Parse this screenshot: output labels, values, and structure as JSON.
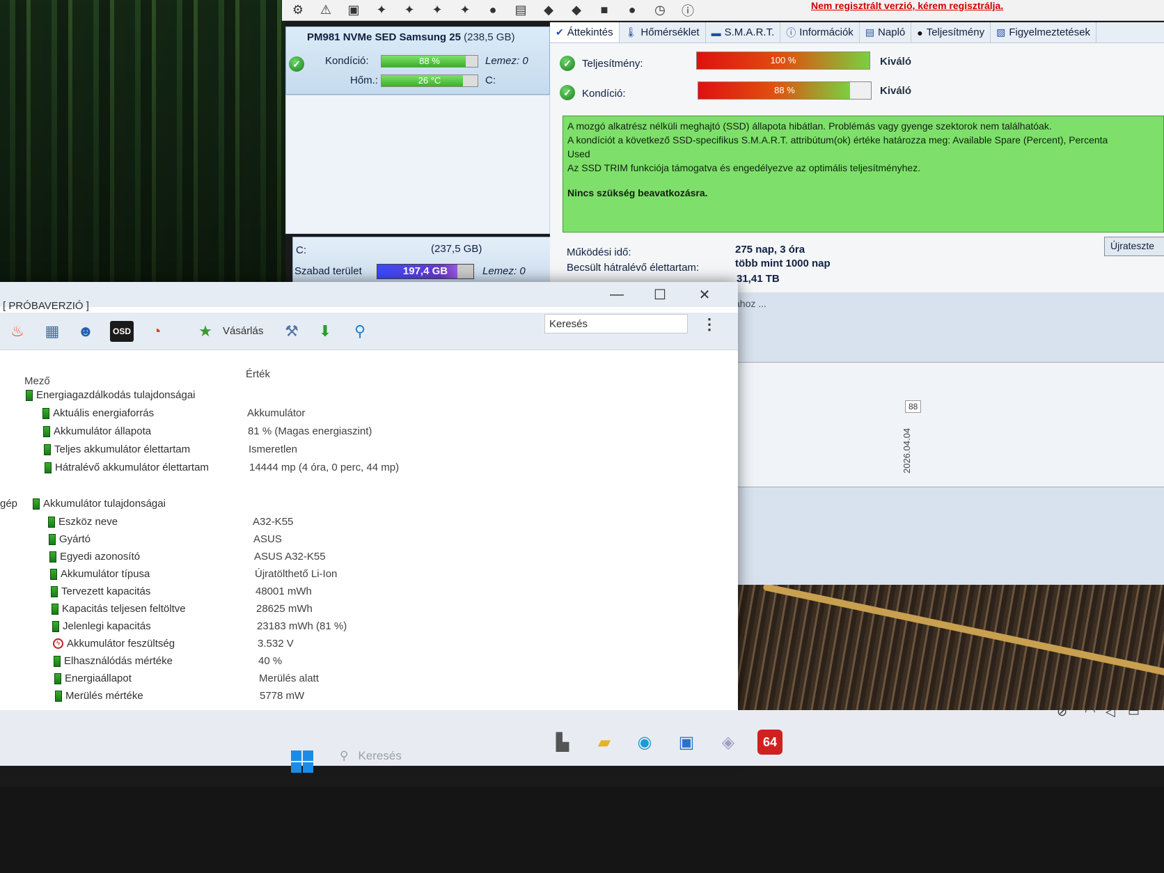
{
  "hdsentinel": {
    "registration_warning": "Nem regisztrált verzió, kérem regisztrálja.",
    "disk_name": "PM981 NVMe SED Samsung 25",
    "disk_size": "(238,5 GB)",
    "condition_label": "Kondíció:",
    "condition_value": "88 %",
    "condition_level": 0.88,
    "disk_label": "Lemez: 0",
    "temp_label": "Hőm.:",
    "temp_value": "26 °C",
    "temp_level": 0.85,
    "drive_letter": "C:",
    "partition_letter": "C:",
    "partition_size": "(237,5 GB)",
    "free_label": "Szabad terület",
    "free_value": "197,4 GB",
    "free_level": 0.83,
    "partition_disk": "Lemez: 0",
    "tabs": [
      "Áttekintés",
      "Hőmérséklet",
      "S.M.A.R.T.",
      "Információk",
      "Napló",
      "Teljesítmény",
      "Figyelmeztetések"
    ],
    "performance_label": "Teljesítmény:",
    "performance_value": "100 %",
    "performance_level": 1.0,
    "performance_rating": "Kiváló",
    "health_label": "Kondíció:",
    "health_value": "88 %",
    "health_level": 0.88,
    "health_rating": "Kiváló",
    "message_lines": [
      "A mozgó alkatrész nélküli meghajtó (SSD) állapota hibátlan. Problémás vagy gyenge szektorok nem találhatóak.",
      "A kondíciót a következő SSD-specifikus S.M.A.R.T. attribútum(ok) értéke határozza meg:  Available Spare (Percent), Percenta",
      "Used",
      "Az SSD TRIM funkciója támogatva és engedélyezve az optimális teljesítményhez."
    ],
    "message_strong": "Nincs szükség beavatkozásra.",
    "uptime_label": "Működési idő:",
    "uptime_value": "275 nap, 3 óra",
    "life_label": "Becsült hátralévő élettartam:",
    "life_value": "több mint 1000 nap",
    "written_value": "31,41 TB",
    "restart_label": "Újrateszte",
    "search_hint": "sához ...",
    "chart_point_label": "88",
    "chart_date_label": "2026.04.04"
  },
  "aida": {
    "title": "[ PRÓBAVERZIÓ ]",
    "buy_label": "Vásárlás",
    "osd_label": "OSD",
    "search_placeholder": "Keresés",
    "col_field": "Mező",
    "col_value": "Érték",
    "side_label": "gép",
    "section1": "Energiagazdálkodás tulajdonságai",
    "rows1": [
      {
        "label": "Aktuális energiaforrás",
        "value": "Akkumulátor"
      },
      {
        "label": "Akkumulátor állapota",
        "value": "81 % (Magas energiaszint)"
      },
      {
        "label": "Teljes akkumulátor élettartam",
        "value": "Ismeretlen"
      },
      {
        "label": "Hátralévő akkumulátor élettartam",
        "value": "14444 mp (4 óra, 0 perc, 44 mp)"
      }
    ],
    "section2": "Akkumulátor tulajdonságai",
    "rows2": [
      {
        "label": "Eszköz neve",
        "value": "A32-K55"
      },
      {
        "label": "Gyártó",
        "value": "ASUS"
      },
      {
        "label": "Egyedi azonosító",
        "value": "ASUS A32-K55"
      },
      {
        "label": "Akkumulátor típusa",
        "value": "Újratölthető Li-Ion"
      },
      {
        "label": "Tervezett kapacitás",
        "value": "48001 mWh"
      },
      {
        "label": "Kapacitás teljesen feltöltve",
        "value": "28625 mWh"
      },
      {
        "label": "Jelenlegi kapacitás",
        "value": "23183 mWh  (81 %)"
      },
      {
        "label": "Akkumulátor feszültség",
        "value": "3.532 V"
      },
      {
        "label": "Elhasználódás mértéke",
        "value": "40 %"
      },
      {
        "label": "Energiaállapot",
        "value": "Merülés alatt"
      },
      {
        "label": "Merülés mértéke",
        "value": "5778 mW"
      }
    ]
  },
  "taskbar": {
    "search_label": "Keresés",
    "aida_badge": "64"
  },
  "icons": [
    "flame-icon",
    "computer-tree-icon",
    "user-icon",
    "osd-icon",
    "gauge-icon",
    "buy-icon",
    "wrench-icon",
    "download-icon",
    "search-icon",
    "wifi-icon",
    "volume-icon",
    "battery-icon"
  ]
}
